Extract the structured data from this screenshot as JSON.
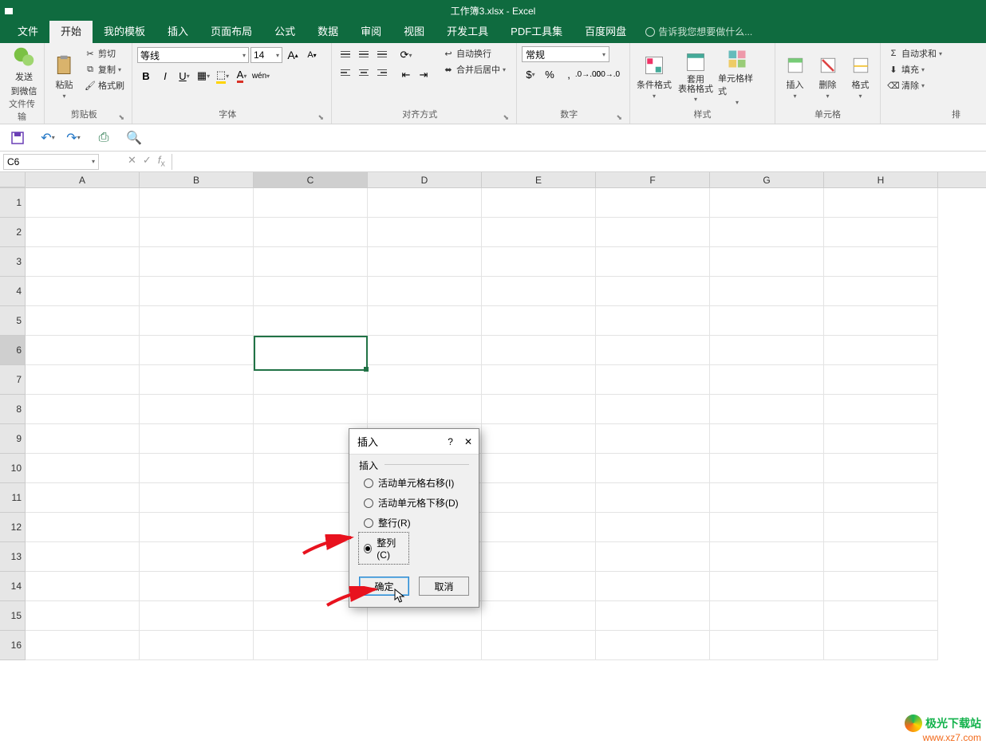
{
  "title": "工作簿3.xlsx - Excel",
  "tabs": {
    "file": "文件",
    "home": "开始",
    "template": "我的模板",
    "insert": "插入",
    "layout": "页面布局",
    "formula": "公式",
    "data": "数据",
    "review": "审阅",
    "view": "视图",
    "dev": "开发工具",
    "pdf": "PDF工具集",
    "baidu": "百度网盘"
  },
  "tellme": "告诉我您想要做什么...",
  "groups": {
    "wechat": {
      "send": "发送",
      "to": "到微信",
      "label": "文件传输"
    },
    "clipboard": {
      "paste": "粘贴",
      "cut": "剪切",
      "copy": "复制",
      "painter": "格式刷",
      "label": "剪贴板"
    },
    "font": {
      "name": "等线",
      "size": "14",
      "label": "字体"
    },
    "align": {
      "wrap": "自动换行",
      "merge": "合并后居中",
      "label": "对齐方式"
    },
    "number": {
      "general": "常规",
      "label": "数字"
    },
    "styles": {
      "cond": "条件格式",
      "table": "套用\n表格格式",
      "cell": "单元格样式",
      "label": "样式"
    },
    "cells": {
      "insert": "插入",
      "delete": "删除",
      "format": "格式",
      "label": "单元格"
    },
    "edit": {
      "sum": "自动求和",
      "fill": "填充",
      "clear": "清除",
      "sort": "排"
    }
  },
  "namebox": "C6",
  "columns": [
    "A",
    "B",
    "C",
    "D",
    "E",
    "F",
    "G",
    "H"
  ],
  "rows": [
    "1",
    "2",
    "3",
    "4",
    "5",
    "6",
    "7",
    "8",
    "9",
    "10",
    "11",
    "12",
    "13",
    "14",
    "15",
    "16"
  ],
  "dialog": {
    "title": "插入",
    "group": "插入",
    "opt1": "活动单元格右移(I)",
    "opt2": "活动单元格下移(D)",
    "opt3": "整行(R)",
    "opt4": "整列(C)",
    "ok": "确定",
    "cancel": "取消"
  },
  "watermark": {
    "name": "极光下载站",
    "url": "www.xz7.com"
  }
}
